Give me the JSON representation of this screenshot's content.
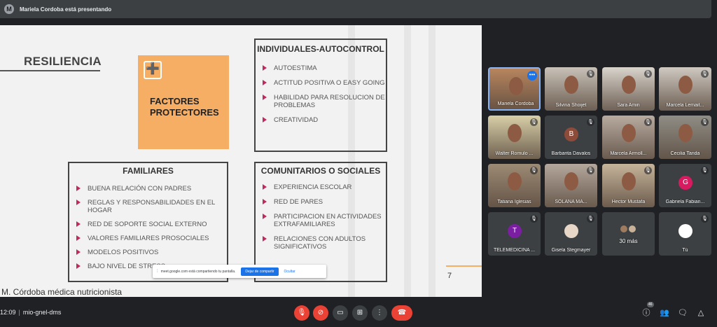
{
  "topbar": {
    "avatar_letter": "M",
    "presenter_text": "Mariela Cordoba está presentando"
  },
  "slide": {
    "title": "RESILIENCIA",
    "orange_box": {
      "icon": "➕",
      "text": "FACTORES PROTECTORES"
    },
    "individuales": {
      "title": "INDIVIDUALES-AUTOCONTROL",
      "items": [
        "AUTOESTIMA",
        "ACTITUD POSITIVA O EASY GOING",
        "HABILIDAD PARA RESOLUCION DE  PROBLEMAS",
        "CREATIVIDAD"
      ]
    },
    "familiares": {
      "title": "FAMILIARES",
      "items": [
        "BUENA RELACIÓN CON PADRES",
        "REGLAS Y RESPONSABILIDADES EN EL HOGAR",
        "RED DE SOPORTE SOCIAL EXTERNO",
        "VALORES FAMILIARES PROSOCIALES",
        "MODELOS POSITIVOS",
        "BAJO NIVEL DE STRESS"
      ]
    },
    "comunitarios": {
      "title": "COMUNITARIOS O SOCIALES",
      "items": [
        "EXPERIENCIA ESCOLAR",
        "RED DE PARES",
        "PARTICIPACION EN ACTIVIDADES EXTRAFAMILIARES",
        "RELACIONES CON ADULTOS SIGNIFICATIVOS"
      ]
    },
    "page_number": "7",
    "author": "M. Córdoba médica nutricionista"
  },
  "share_banner": {
    "text": "meet.google.com está compartiendo tu pantalla.",
    "stop_label": "Dejar de compartir",
    "hide_label": "Ocultar"
  },
  "participants": [
    {
      "name": "Mariela Cordoba",
      "kind": "video",
      "bg": "#b7855e"
    },
    {
      "name": "Silvina Shoijet",
      "kind": "video",
      "bg": "#c9c2b8"
    },
    {
      "name": "Sara Amin",
      "kind": "video",
      "bg": "#d9d4cc"
    },
    {
      "name": "Marcela Lemait...",
      "kind": "video",
      "bg": "#cfc9c1"
    },
    {
      "name": "Walter Romulo ...",
      "kind": "video",
      "bg": "#d8cfa8"
    },
    {
      "name": "Barbarita Davalos",
      "kind": "avatar",
      "letter": "B",
      "avatar_color": "#8d4c3a"
    },
    {
      "name": "Marcela Armoll...",
      "kind": "video",
      "bg": "#b8aba0"
    },
    {
      "name": "Cecilia Tanda",
      "kind": "video",
      "bg": "#8f8d85"
    },
    {
      "name": "Tatiana Iglesias",
      "kind": "video",
      "bg": "#9c8a74"
    },
    {
      "name": "SOLANA MA...",
      "kind": "video",
      "bg": "#b4a79c"
    },
    {
      "name": "Hector Mustafa",
      "kind": "video",
      "bg": "#c6b49a"
    },
    {
      "name": "Gabriela Fabian...",
      "kind": "avatar",
      "letter": "G",
      "avatar_color": "#d81b60"
    },
    {
      "name": "TELEMEDICINA ...",
      "kind": "avatar",
      "letter": "T",
      "avatar_color": "#7b1fa2"
    },
    {
      "name": "Gisela Stegmayer",
      "kind": "photo",
      "avatar_color": "#e8d7c6"
    },
    {
      "name": "30 más",
      "kind": "more"
    },
    {
      "name": "Tú",
      "kind": "photo",
      "avatar_color": "#ffffff"
    }
  ],
  "bottombar": {
    "time": "12:09",
    "meeting_code": "mio-gnel-dms",
    "participant_count": "46"
  }
}
